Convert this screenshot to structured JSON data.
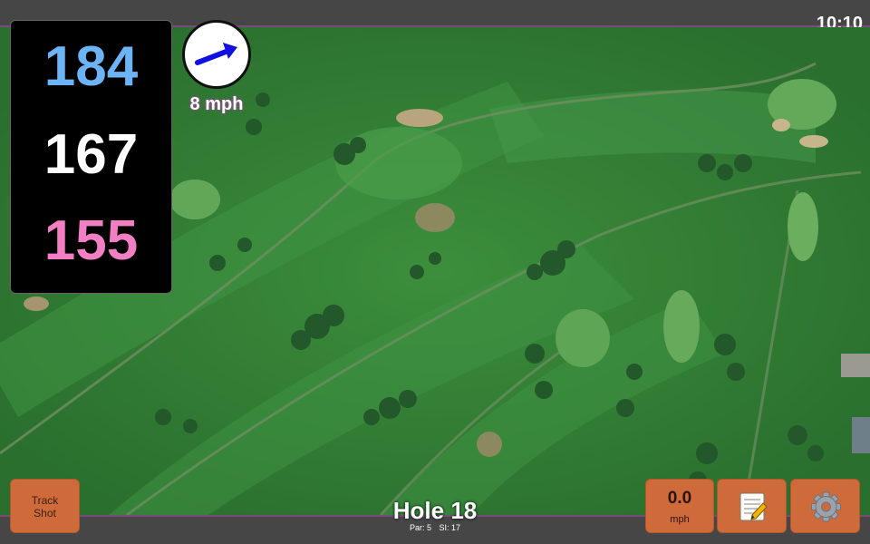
{
  "status": {
    "time": "10:10"
  },
  "distances": {
    "back": "184",
    "middle": "167",
    "front": "155"
  },
  "wind": {
    "speed": "8 mph",
    "direction_icon": "arrow-icon"
  },
  "hole": {
    "title": "Hole 18",
    "par": "Par: 5",
    "si": "SI: 17"
  },
  "buttons": {
    "track_line1": "Track",
    "track_line2": "Shot",
    "speed_value": "0.0",
    "speed_unit": "mph",
    "notes_icon": "notepad-icon",
    "settings_icon": "gear-icon"
  },
  "colors": {
    "back_distance": "#6cb4f5",
    "middle_distance": "#ffffff",
    "front_distance": "#f27fc4",
    "button": "#cf6b3b",
    "turf": "#2f7a33"
  }
}
